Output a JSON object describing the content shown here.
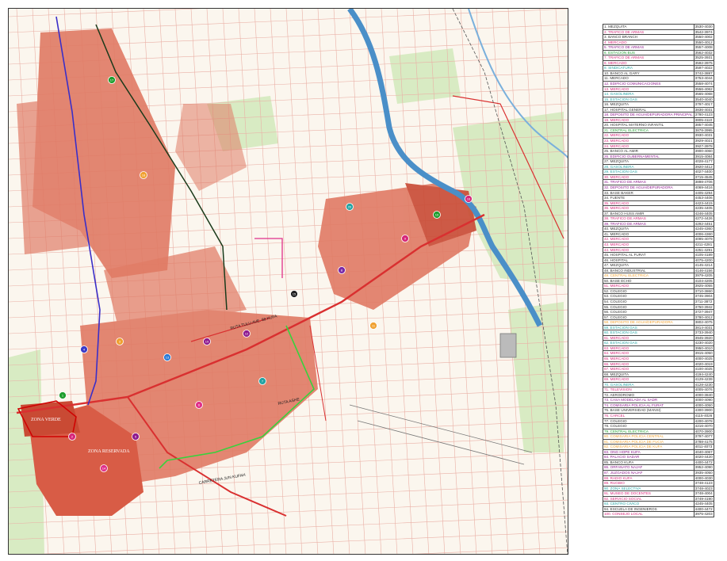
{
  "map": {
    "colors": {
      "urban": "#e0705a",
      "urban_dense": "#c94a34",
      "river": "#4a8fc8",
      "road": "#d93030",
      "route_green": "#39d13d",
      "route_black": "#1a3a1a",
      "route_blue": "#3a2ec8",
      "route_magenta": "#e0308a",
      "grid": "#e8a8a0",
      "field": "#9acd7a"
    },
    "labels": {
      "zone_a": "ZONA VERDE",
      "zone_b": "ZONA RESERVADA",
      "road_a": "RUTA TULU AVE. 88 KUFA",
      "road_b": "CARRETERA JUN KUFAH",
      "road_c": "RUTA ASHE"
    },
    "markers": [
      {
        "n": "1",
        "c": "#1e9e2e"
      },
      {
        "n": "2",
        "c": "#d6277a"
      },
      {
        "n": "3",
        "c": "#f0a030"
      },
      {
        "n": "4",
        "c": "#3a3ac8"
      },
      {
        "n": "5",
        "c": "#8e1a8e"
      },
      {
        "n": "6",
        "c": "#e0308a"
      },
      {
        "n": "7",
        "c": "#23a3a3"
      },
      {
        "n": "8",
        "c": "#7a2aa8"
      },
      {
        "n": "9",
        "c": "#d6277a"
      },
      {
        "n": "10",
        "c": "#1e9e2e"
      },
      {
        "n": "11",
        "c": "#f0a030"
      },
      {
        "n": "12",
        "c": "#8e1a8e"
      },
      {
        "n": "13",
        "c": "#2a7ad6"
      },
      {
        "n": "14",
        "c": "#e0308a"
      },
      {
        "n": "15",
        "c": "#202020"
      },
      {
        "n": "16",
        "c": "#d6277a"
      },
      {
        "n": "17",
        "c": "#1e9e2e"
      },
      {
        "n": "18",
        "c": "#f0a030"
      },
      {
        "n": "19",
        "c": "#8e1a8e"
      },
      {
        "n": "20",
        "c": "#23a3a3"
      }
    ]
  },
  "legend": {
    "rows": [
      {
        "name": "1. MEZQUITA",
        "code": "3530-4030",
        "color": "#333333"
      },
      {
        "name": "2. TRAFICO DE ARMAS",
        "code": "3542-3974",
        "color": "#d6277a"
      },
      {
        "name": "3. BANCO BRANCH",
        "code": "3550-4002",
        "color": "#333333"
      },
      {
        "name": "4. MERCADO",
        "code": "3550-4012",
        "color": "#d6277a"
      },
      {
        "name": "5. TRAFICO DE ARMAS",
        "code": "3557-4008",
        "color": "#8e1a8e"
      },
      {
        "name": "6. ESTACION BUS",
        "code": "3562-4032",
        "color": "#1e9e2e"
      },
      {
        "name": "7. TRAFICO DE ARMAS",
        "code": "3525-3931",
        "color": "#d6277a"
      },
      {
        "name": "8. MERCADO",
        "code": "3592-3975",
        "color": "#d6277a"
      },
      {
        "name": "9. SINDICATURA",
        "code": "3597-4022",
        "color": "#23a3a3"
      },
      {
        "name": "10. BANCO AL GARY",
        "code": "3742-3887",
        "color": "#333333"
      },
      {
        "name": "11. MERCADO",
        "code": "3753-4044",
        "color": "#333333"
      },
      {
        "name": "12. EDIFICIO COMUNICACIONES",
        "code": "3558-4074",
        "color": "#8e1a8e"
      },
      {
        "name": "13. MERCADO",
        "code": "3556-4062",
        "color": "#d6277a"
      },
      {
        "name": "14. GASOLINERA",
        "code": "3565-4068",
        "color": "#23a3a3"
      },
      {
        "name": "15. ESTACION GAS",
        "code": "3540-4040",
        "color": "#23a3a3"
      },
      {
        "name": "16. MEZQUITA",
        "code": "3797-4017",
        "color": "#333333"
      },
      {
        "name": "17. HOSPITAL GENERAL",
        "code": "3836-4031",
        "color": "#333333"
      },
      {
        "name": "18. DEPOSITO DE AGUA/DEPURADORA PRINCIPAL",
        "code": "3780-4123",
        "color": "#8e1a8e"
      },
      {
        "name": "19. MERCADO",
        "code": "3805-4110",
        "color": "#d6277a"
      },
      {
        "name": "20. HOSPITAL MATERNO INFANTIL",
        "code": "3857-4045",
        "color": "#333333"
      },
      {
        "name": "21. CENTRAL ELECTRICA",
        "code": "3878-3995",
        "color": "#1e9e2e"
      },
      {
        "name": "22. MERCADO",
        "code": "3930-4031",
        "color": "#d6277a"
      },
      {
        "name": "23. MERCADO",
        "code": "3929-4021",
        "color": "#d6277a"
      },
      {
        "name": "24. MERCADO",
        "code": "3927-3978",
        "color": "#d6277a"
      },
      {
        "name": "25. BANCO AL AMIR",
        "code": "3900-4060",
        "color": "#333333"
      },
      {
        "name": "26. EDIFICIO GUBERNAMENTAL",
        "code": "3915-4084",
        "color": "#8e1a8e"
      },
      {
        "name": "27. MEZQUITA",
        "code": "4028-4177",
        "color": "#333333"
      },
      {
        "name": "28. GASOLINERA",
        "code": "3920-4412",
        "color": "#23a3a3"
      },
      {
        "name": "29. ESTACION GAS",
        "code": "4027-4400",
        "color": "#23a3a3"
      },
      {
        "name": "30. MERCADO",
        "code": "3715-4545",
        "color": "#d6277a"
      },
      {
        "name": "31. TRAFICO DE ARMAS",
        "code": "3898-4706",
        "color": "#8e1a8e"
      },
      {
        "name": "32. DEPOSITO DE AGUA/DEPURADORA",
        "code": "4069-4416",
        "color": "#8e1a8e"
      },
      {
        "name": "33. BASE BAKER",
        "code": "4405-4294",
        "color": "#333333"
      },
      {
        "name": "34. FUENTE",
        "code": "4453-4406",
        "color": "#333333"
      },
      {
        "name": "35. MERCADO",
        "code": "4423-4415",
        "color": "#d6277a"
      },
      {
        "name": "36. MERCADO",
        "code": "4235-4405",
        "color": "#d6277a"
      },
      {
        "name": "37. BANCO HUSS AMIR",
        "code": "4246-4405",
        "color": "#333333"
      },
      {
        "name": "38. TRAFICO DE ARMAS",
        "code": "4272-4426",
        "color": "#d6277a"
      },
      {
        "name": "39. TRAFICO DE ARMAS",
        "code": "4292-4451",
        "color": "#8e1a8e"
      },
      {
        "name": "40. MEZQUITA",
        "code": "4245-4360",
        "color": "#333333"
      },
      {
        "name": "41. MERCADO",
        "code": "4006-4360",
        "color": "#333333"
      },
      {
        "name": "42. MERCADO",
        "code": "4095-4079",
        "color": "#d6277a"
      },
      {
        "name": "43. MERCADO",
        "code": "4211-4281",
        "color": "#d6277a"
      },
      {
        "name": "44. MERCADO",
        "code": "4251-4291",
        "color": "#d6277a"
      },
      {
        "name": "45. HOSPITAL AL FURAT",
        "code": "4105-4189",
        "color": "#333333"
      },
      {
        "name": "46. HOSPITAL",
        "code": "4075-4200",
        "color": "#333333"
      },
      {
        "name": "47. MEZQUITA",
        "code": "4145-4214",
        "color": "#333333"
      },
      {
        "name": "48. BANCO INDUSTRIAL",
        "code": "4146-4156",
        "color": "#333333"
      },
      {
        "name": "49. CENTRAL ELECTRICA",
        "code": "3979-4205",
        "color": "#f0a030"
      },
      {
        "name": "50. BASE ECHO",
        "code": "4104-4205",
        "color": "#333333"
      },
      {
        "name": "51. MERCADO",
        "code": "3925-4055",
        "color": "#d6277a"
      },
      {
        "name": "52. COLEGIO",
        "code": "3710-3860",
        "color": "#333333"
      },
      {
        "name": "53. COLEGIO",
        "code": "3745-3904",
        "color": "#333333"
      },
      {
        "name": "54. COLEGIO",
        "code": "3711-3872",
        "color": "#333333"
      },
      {
        "name": "55. COLEGIO",
        "code": "3750-3942",
        "color": "#333333"
      },
      {
        "name": "56. COLEGIO",
        "code": "3727-3947",
        "color": "#333333"
      },
      {
        "name": "57. COLEGIO",
        "code": "3780-4012",
        "color": "#333333"
      },
      {
        "name": "58. DEPOSITO DE AGUA/DEPURADORA",
        "code": "3802-4075",
        "color": "#f0a030"
      },
      {
        "name": "59. ESTACION GAS",
        "code": "3814-4031",
        "color": "#23a3a3"
      },
      {
        "name": "60. ESTACION GAS",
        "code": "3733-3940",
        "color": "#23a3a3"
      },
      {
        "name": "61. MERCADO",
        "code": "3945-3920",
        "color": "#d6277a"
      },
      {
        "name": "62. ESTACION GAS",
        "code": "4230-4020",
        "color": "#23a3a3"
      },
      {
        "name": "63. MERCADO",
        "code": "3950-4010",
        "color": "#d6277a"
      },
      {
        "name": "64. MERCADO",
        "code": "3915-4050",
        "color": "#d6277a"
      },
      {
        "name": "65. MERCADO",
        "code": "4000-4025",
        "color": "#d6277a"
      },
      {
        "name": "66. MERCADO",
        "code": "4020-4019",
        "color": "#d6277a"
      },
      {
        "name": "67. MERCADO",
        "code": "4100-4025",
        "color": "#d6277a"
      },
      {
        "name": "68. MEZQUITA",
        "code": "4194-4240",
        "color": "#333333"
      },
      {
        "name": "69. MERCADO",
        "code": "4129-4239",
        "color": "#d6277a"
      },
      {
        "name": "70. GASOLINERA",
        "code": "4128-4230",
        "color": "#23a3a3"
      },
      {
        "name": "71. TELEVISION",
        "code": "4005-4076",
        "color": "#d6277a"
      },
      {
        "name": "72. AERODROMO",
        "code": "4000-3840",
        "color": "#333333"
      },
      {
        "name": "73. CASA MODELADA AL SADR",
        "code": "4000-4090",
        "color": "#8e1a8e"
      },
      {
        "name": "74. COMISARIA POLICIA AL FURAT",
        "code": "4000-4050",
        "color": "#8e1a8e"
      },
      {
        "name": "75. BASE UNIVERSIDAD (MANSI)",
        "code": "4300-3900",
        "color": "#333333"
      },
      {
        "name": "76. CARCEL",
        "code": "4115-4026",
        "color": "#d6277a"
      },
      {
        "name": "77. COLEGIO",
        "code": "4200-4078",
        "color": "#333333"
      },
      {
        "name": "78. COLEGIO",
        "code": "4216-4070",
        "color": "#333333"
      },
      {
        "name": "79. CENTRAL ELECTRICA",
        "code": "4070-3900",
        "color": "#1e9e2e"
      },
      {
        "name": "80. COMISARIA POLICIA CENTRAL",
        "code": "3797-4077",
        "color": "#f0a030"
      },
      {
        "name": "81. COMISARIA POLICIA DE FUCIA",
        "code": "3788-4175",
        "color": "#f0a030"
      },
      {
        "name": "82. COMISARIA POLICIA DE KUFA",
        "code": "4011-4073",
        "color": "#f0a030"
      },
      {
        "name": "83. ONG HOPE KUFA",
        "code": "4040-4067",
        "color": "#8e1a8e"
      },
      {
        "name": "84. PALACIO SADAR",
        "code": "4020-4420",
        "color": "#8e1a8e"
      },
      {
        "name": "85. BANCO KUFA",
        "code": "4400-4472",
        "color": "#333333"
      },
      {
        "name": "86. ORFANATO NAJAF",
        "code": "3952-4090",
        "color": "#8e1a8e"
      },
      {
        "name": "87. JUZGADOS NAJAF",
        "code": "3935-4050",
        "color": "#8e1a8e"
      },
      {
        "name": "88. RADIO KUFA",
        "code": "4000-4030",
        "color": "#d6277a"
      },
      {
        "name": "89. RUGBIO",
        "code": "3748-4123",
        "color": "#d6277a"
      },
      {
        "name": "90. ZONA SELECTIVA",
        "code": "3748-4023",
        "color": "#23a3a3"
      },
      {
        "name": "91. MUSEO DE DOCENTES",
        "code": "3748-4004",
        "color": "#d6277a"
      },
      {
        "name": "92. SERVICIO SOCIAL",
        "code": "3749-4190",
        "color": "#d6277a"
      },
      {
        "name": "93. CENTRO CIVICO",
        "code": "4245-4405",
        "color": "#23a3a3"
      },
      {
        "name": "94. ESCUELA DE INGENIEROS",
        "code": "4400-4472",
        "color": "#333333"
      },
      {
        "name": "100. CONSEJO LOCAL",
        "code": "3975-4203",
        "color": "#d6277a"
      }
    ]
  }
}
